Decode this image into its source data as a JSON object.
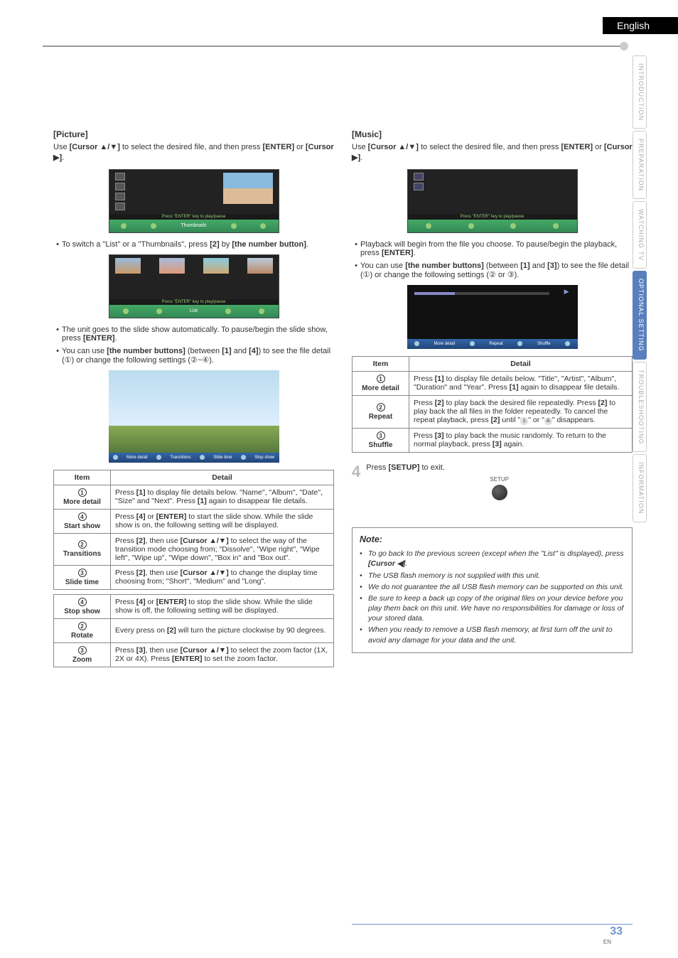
{
  "header": {
    "lang": "English"
  },
  "side_tabs": [
    "INTRODUCTION",
    "PREPARATION",
    "WATCHING TV",
    "OPTIONAL SETTING",
    "TROUBLESHOOTING",
    "INFORMATION"
  ],
  "picture": {
    "title": "[Picture]",
    "intro_before": "Use ",
    "intro_cursor": "[Cursor ▲/▼]",
    "intro_mid": " to select the desired file, and then press ",
    "intro_enter": "[ENTER]",
    "intro_or": " or ",
    "intro_cursor_r": "[Cursor ▶]",
    "intro_end": ".",
    "shot1_bar_label": "Thumbnails",
    "shot1_sub": "Press \"ENTER\" key to play/pause",
    "bullet1_a": "To switch a \"List\" or a \"Thumbnails\", press ",
    "bullet1_b": "[2]",
    "bullet1_c": " by ",
    "bullet1_d": "[the number button]",
    "bullet1_e": ".",
    "shot2_bar_label": "List",
    "shot2_sub": "Press \"ENTER\" key to play/pause",
    "bullet2_a": "The unit goes to the slide show automatically. To pause/begin the slide show, press ",
    "bullet2_b": "[ENTER]",
    "bullet2_c": ".",
    "bullet3_a": "You can use ",
    "bullet3_b": "[the number buttons]",
    "bullet3_c": " (between ",
    "bullet3_d": "[1]",
    "bullet3_e": " and ",
    "bullet3_f": "[4]",
    "bullet3_g": ") to see the file detail (①) or change the following settings (②~④).",
    "shot3_labels": [
      "More detail",
      "Transitions",
      "Slide time",
      "Stop show"
    ],
    "table1_h1": "Item",
    "table1_h2": "Detail",
    "t1r1_item": "More detail",
    "t1r1_a": "Press ",
    "t1r1_b": "[1]",
    "t1r1_c": " to display file details below. \"Name\", \"Album\", \"Date\", \"Size\" and \"Next\". Press ",
    "t1r1_d": "[1]",
    "t1r1_e": " again to disappear file details.",
    "t1r2_item": "Start show",
    "t1r2_a": "Press ",
    "t1r2_b": "[4]",
    "t1r2_c": " or ",
    "t1r2_d": "[ENTER]",
    "t1r2_e": " to start the slide show. While the slide show is on, the following setting will be displayed.",
    "t1r3_item": "Transitions",
    "t1r3_a": "Press ",
    "t1r3_b": "[2]",
    "t1r3_c": ", then use ",
    "t1r3_d": "[Cursor ▲/▼]",
    "t1r3_e": " to select the way of the transition mode choosing from; \"Dissolve\", \"Wipe right\", \"Wipe left\", \"Wipe up\", \"Wipe down\", \"Box in\" and \"Box out\".",
    "t1r4_item": "Slide time",
    "t1r4_a": "Press ",
    "t1r4_b": "[2]",
    "t1r4_c": ", then use ",
    "t1r4_d": "[Cursor ▲/▼]",
    "t1r4_e": " to change the display time choosing from; \"Short\", \"Medium\" and \"Long\".",
    "t1r5_item": "Stop show",
    "t1r5_a": "Press ",
    "t1r5_b": "[4]",
    "t1r5_c": " or ",
    "t1r5_d": "[ENTER]",
    "t1r5_e": " to stop the slide show. While the slide show is off, the following setting will be displayed.",
    "t1r6_item": "Rotate",
    "t1r6_a": "Every press on ",
    "t1r6_b": "[2]",
    "t1r6_c": " will turn the picture clockwise by 90 degrees.",
    "t1r7_item": "Zoom",
    "t1r7_a": "Press ",
    "t1r7_b": "[3]",
    "t1r7_c": ", then use ",
    "t1r7_d": "[Cursor ▲/▼]",
    "t1r7_e": " to select the zoom factor (1X, 2X or 4X). Press ",
    "t1r7_f": "[ENTER]",
    "t1r7_g": " to set the zoom factor."
  },
  "music": {
    "title": "[Music]",
    "intro_before": "Use ",
    "intro_cursor": "[Cursor ▲/▼]",
    "intro_mid": " to select the desired file, and then press ",
    "intro_enter": "[ENTER]",
    "intro_or": " or ",
    "intro_cursor_r": "[Cursor ▶]",
    "intro_end": ".",
    "shot1_sub": "Press \"ENTER\" key to play/pause",
    "bullet1_a": "Playback will begin from the file you choose. To pause/begin the playback, press ",
    "bullet1_b": "[ENTER]",
    "bullet1_c": ".",
    "bullet2_a": "You can use ",
    "bullet2_b": "[the number buttons]",
    "bullet2_c": " (between ",
    "bullet2_d": "[1]",
    "bullet2_e": " and ",
    "bullet2_f": "[3]",
    "bullet2_g": ") to see the file detail (①) or change the following settings (② or ③).",
    "shot2_labels": [
      "More detail",
      "Repeat",
      "Shuffle",
      ""
    ],
    "table2_h1": "Item",
    "table2_h2": "Detail",
    "t2r1_item": "More detail",
    "t2r1_a": "Press ",
    "t2r1_b": "[1]",
    "t2r1_c": " to display file details below. \"Title\", \"Artist\", \"Album\", \"Duration\" and \"Year\". Press ",
    "t2r1_d": "[1]",
    "t2r1_e": " again to disappear file details.",
    "t2r2_item": "Repeat",
    "t2r2_a": "Press ",
    "t2r2_b": "[2]",
    "t2r2_c": " to play back the desired file repeatedly. Press ",
    "t2r2_d": "[2]",
    "t2r2_e": " to play back the all files in the folder repeatedly. To cancel the repeat playback, press ",
    "t2r2_f": "[2]",
    "t2r2_g": " until \"",
    "t2r2_h": "\" or \"",
    "t2r2_i": "\" disappears.",
    "t2r3_item": "Shuffle",
    "t2r3_a": "Press ",
    "t2r3_b": "[3]",
    "t2r3_c": " to play back the music randomly. To return to the normal playback, press ",
    "t2r3_d": "[3]",
    "t2r3_e": " again."
  },
  "step4": {
    "num": "4",
    "text_a": "Press ",
    "text_b": "[SETUP]",
    "text_c": " to exit.",
    "btn_label": "SETUP"
  },
  "note": {
    "title": "Note:",
    "n1_a": "To go back to the previous screen (except when the \"List\" is displayed), press ",
    "n1_b": "[Cursor ◀]",
    "n1_c": ".",
    "n2": "The USB flash memory is not supplied with this unit.",
    "n3": "We do not guarantee the all USB flash memory can be supported on this unit.",
    "n4": "Be sure to keep a back up copy of the original files on your device before you play them back on this unit. We have no responsibilities for damage or loss of your stored data.",
    "n5": "When you ready to remove a USB flash memory, at first turn off the unit to avoid any damage for your data and the unit."
  },
  "page": {
    "num": "33",
    "en": "EN"
  }
}
